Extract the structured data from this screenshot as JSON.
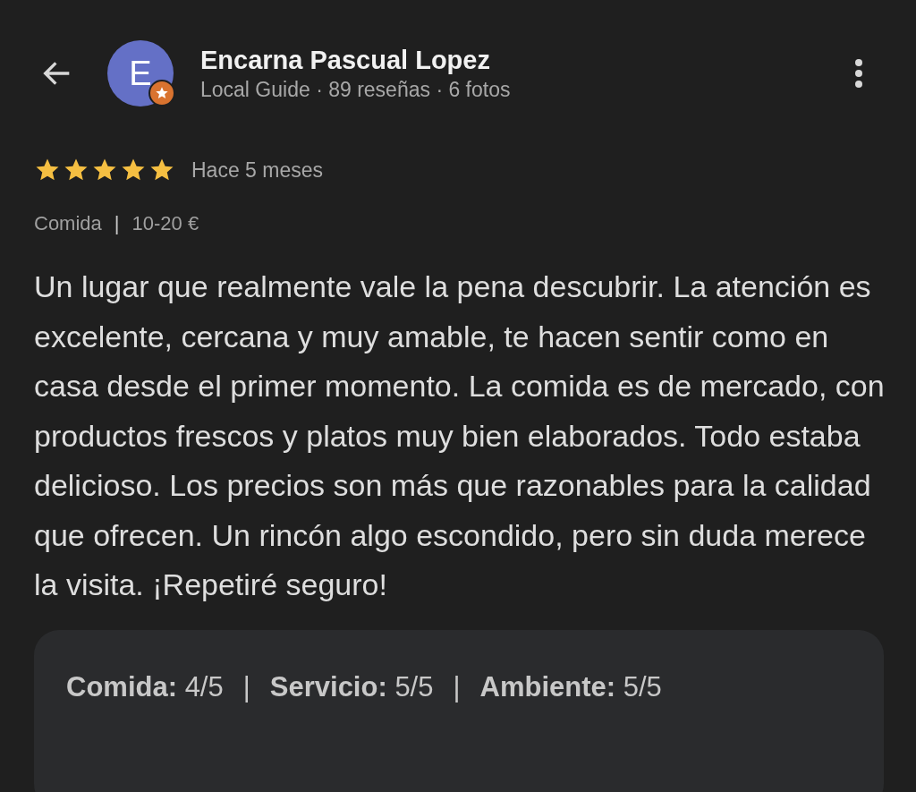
{
  "header": {
    "avatar_letter": "E",
    "name": "Encarna Pascual Lopez",
    "subtitle": "Local Guide · 89 reseñas · 6 fotos"
  },
  "review": {
    "stars": 5,
    "time": "Hace 5 meses",
    "meta": [
      "Comida",
      "10-20 €"
    ],
    "meta_separator": "|",
    "text": "Un lugar que realmente vale la pena descubrir. La atención es excelente, cercana y muy amable, te hacen sentir como en casa desde el primer momento. La comida es de mercado, con productos frescos y platos muy bien elaborados. Todo estaba delicioso. Los precios son más que razonables para la calidad que ofrecen. Un rincón algo escondido, pero sin duda merece la visita. ¡Repetiré seguro!"
  },
  "ratings": {
    "separator": "|",
    "items": [
      {
        "label": "Comida:",
        "value": "4/5"
      },
      {
        "label": "Servicio:",
        "value": "5/5"
      },
      {
        "label": "Ambiente:",
        "value": "5/5"
      }
    ]
  }
}
